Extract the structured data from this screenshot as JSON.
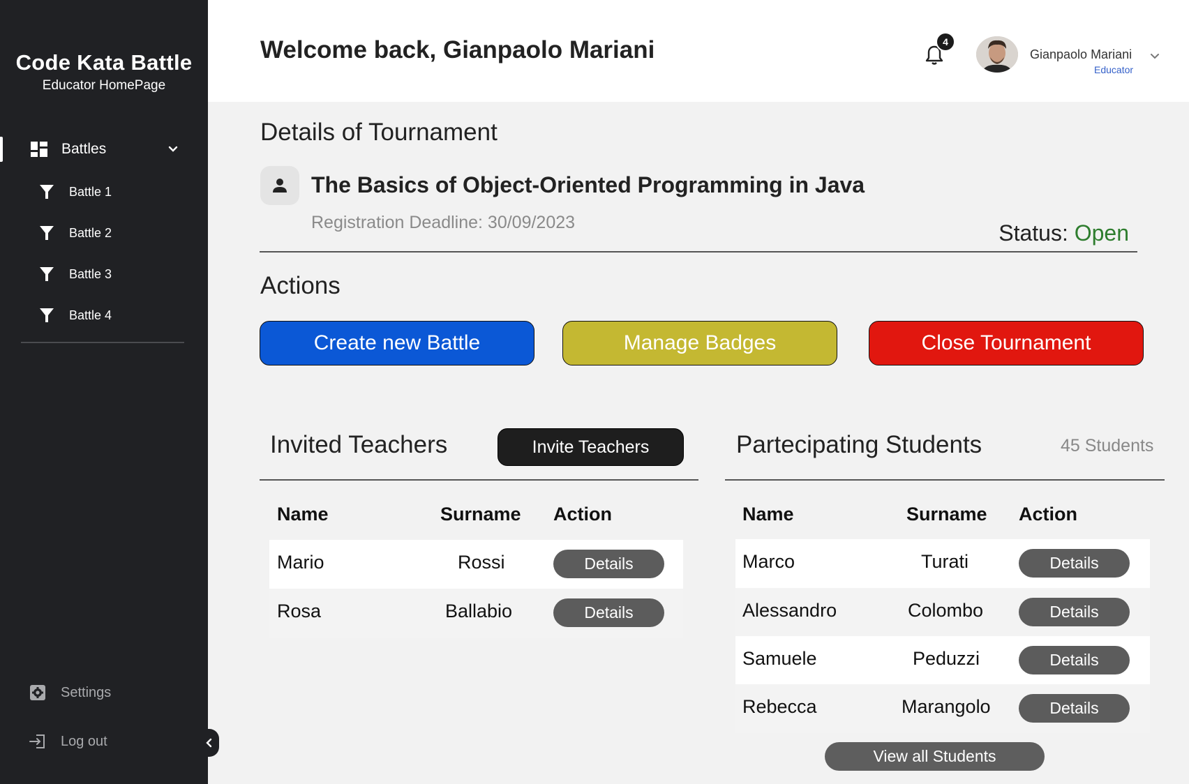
{
  "sidebar": {
    "brand_title": "Code Kata Battle",
    "brand_subtitle": "Educator HomePage",
    "main_item": "Battles",
    "battles": [
      "Battle 1",
      "Battle 2",
      "Battle 3",
      "Battle 4"
    ],
    "settings_label": "Settings",
    "logout_label": "Log out"
  },
  "header": {
    "welcome": "Welcome back, Gianpaolo Mariani",
    "notification_count": "4",
    "user_name": "Gianpaolo Mariani",
    "user_role": "Educator"
  },
  "tournament": {
    "section_title": "Details of Tournament",
    "name": "The Basics of Object-Oriented Programming in Java",
    "deadline": "Registration Deadline: 30/09/2023",
    "status_label": "Status: ",
    "status_value": "Open"
  },
  "actions": {
    "title": "Actions",
    "create_battle": "Create new Battle",
    "manage_badges": "Manage Badges",
    "close_tournament": "Close Tournament"
  },
  "teachers": {
    "title": "Invited Teachers",
    "invite_button": "Invite Teachers",
    "columns": [
      "Name",
      "Surname",
      "Action"
    ],
    "rows": [
      {
        "name": "Mario",
        "surname": "Rossi",
        "action": "Details"
      },
      {
        "name": "Rosa",
        "surname": "Ballabio",
        "action": "Details"
      }
    ]
  },
  "students": {
    "title": "Partecipating Students",
    "count": "45 Students",
    "columns": [
      "Name",
      "Surname",
      "Action"
    ],
    "rows": [
      {
        "name": "Marco",
        "surname": "Turati",
        "action": "Details"
      },
      {
        "name": "Alessandro",
        "surname": "Colombo",
        "action": "Details"
      },
      {
        "name": "Samuele",
        "surname": "Peduzzi",
        "action": "Details"
      },
      {
        "name": "Rebecca",
        "surname": "Marangolo",
        "action": "Details"
      }
    ],
    "view_all": "View all Students"
  },
  "colors": {
    "sidebar_bg": "#202124",
    "create_button": "#0b58d6",
    "badges_button": "#c4b832",
    "close_button": "#e1170f",
    "status_open": "#2e7d2e",
    "role_text": "#3460c9"
  }
}
